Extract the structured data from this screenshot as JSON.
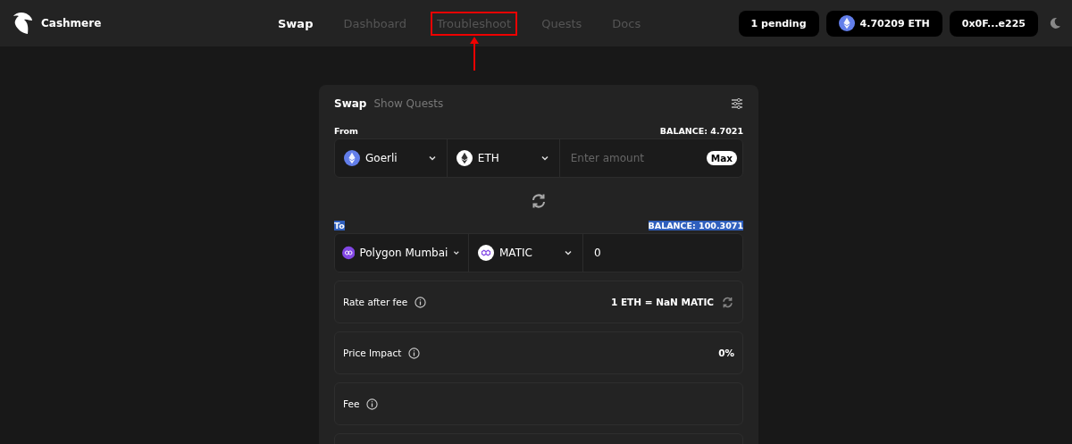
{
  "brand": {
    "name": "Cashmere"
  },
  "nav": [
    {
      "label": "Swap",
      "selected": true,
      "highlighted": false
    },
    {
      "label": "Dashboard",
      "selected": false,
      "highlighted": false
    },
    {
      "label": "Troubleshoot",
      "selected": false,
      "highlighted": true
    },
    {
      "label": "Quests",
      "selected": false,
      "highlighted": false
    },
    {
      "label": "Docs",
      "selected": false,
      "highlighted": false
    }
  ],
  "header_buttons": [
    {
      "label": "1 pending",
      "kind": "text"
    },
    {
      "label": "4.70209 ETH",
      "kind": "balance"
    },
    {
      "label": "0x0F...e225",
      "kind": "text"
    }
  ],
  "card_tabs": [
    {
      "label": "Swap",
      "selected": true
    },
    {
      "label": "Show Quests",
      "selected": false
    }
  ],
  "from": {
    "label": "From",
    "balance": "BALANCE: 4.7021",
    "text_selected": false,
    "chain": {
      "name": "Goerli",
      "kind": "eth-blue"
    },
    "token": {
      "name": "ETH",
      "kind": "eth-white"
    },
    "amount": {
      "placeholder": "Enter amount"
    },
    "max": "Max"
  },
  "to": {
    "label": "To",
    "balance": "BALANCE: 100.3071",
    "text_selected": true,
    "chain": {
      "name": "Polygon Mumbai",
      "kind": "poly-purple"
    },
    "token": {
      "name": "MATIC",
      "kind": "poly-white"
    },
    "amount": {
      "value": "0"
    }
  },
  "details": [
    {
      "label": "Rate after fee",
      "value": "1 ETH = NaN MATIC",
      "refresh": true
    },
    {
      "label": "Price Impact",
      "value": "0%",
      "refresh": false
    },
    {
      "label": "Fee",
      "refresh": false
    }
  ]
}
